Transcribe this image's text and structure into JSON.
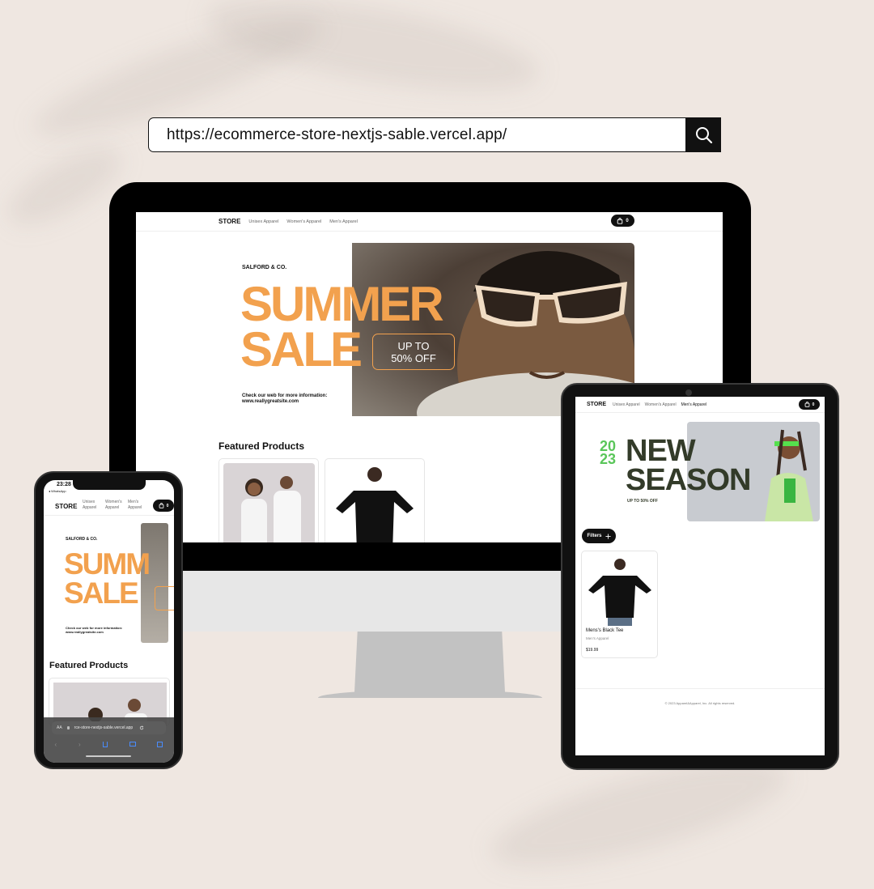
{
  "url_bar": {
    "url": "https://ecommerce-store-nextjs-sable.vercel.app/",
    "search_icon": "search-icon"
  },
  "store": {
    "logo": "STORE",
    "nav": [
      "Unisex Apparel",
      "Women's Apparel",
      "Men's Apparel"
    ],
    "cart_count": "0"
  },
  "desktop": {
    "hero": {
      "brand": "SALFORD & CO.",
      "line1": "SUMMER",
      "line2": "SALE",
      "offer_line1": "UP TO",
      "offer_line2": "50% OFF",
      "info_line1": "Check our web for more information:",
      "info_line2": "www.reallygreatsite.com"
    },
    "featured_title": "Featured Products"
  },
  "tablet": {
    "hero": {
      "year_top": "20",
      "year_bottom": "23",
      "line1": "NEW",
      "line2": "SEASON",
      "sub": "UP TO 50% OFF"
    },
    "filters_label": "Filters",
    "product": {
      "name": "Mens's Black Tee",
      "category": "Men's Apparel",
      "price": "$19.99"
    },
    "footer": "© 2023 Apparel&Apparel, Inc. All rights reserved."
  },
  "phone": {
    "time": "23:28",
    "back_app": "◂ WhatsApp",
    "nav": [
      "Unisex Apparel",
      "Women's Apparel",
      "Men's Apparel"
    ],
    "hero": {
      "line1": "SUMM",
      "line2": "SALE"
    },
    "address": "rce-store-nextjs-sable.vercel.app",
    "text_size_label": "AA"
  },
  "colors": {
    "accent_orange": "#f2a14e",
    "new_season_green": "#5ac65a",
    "dark_olive": "#333b29"
  }
}
